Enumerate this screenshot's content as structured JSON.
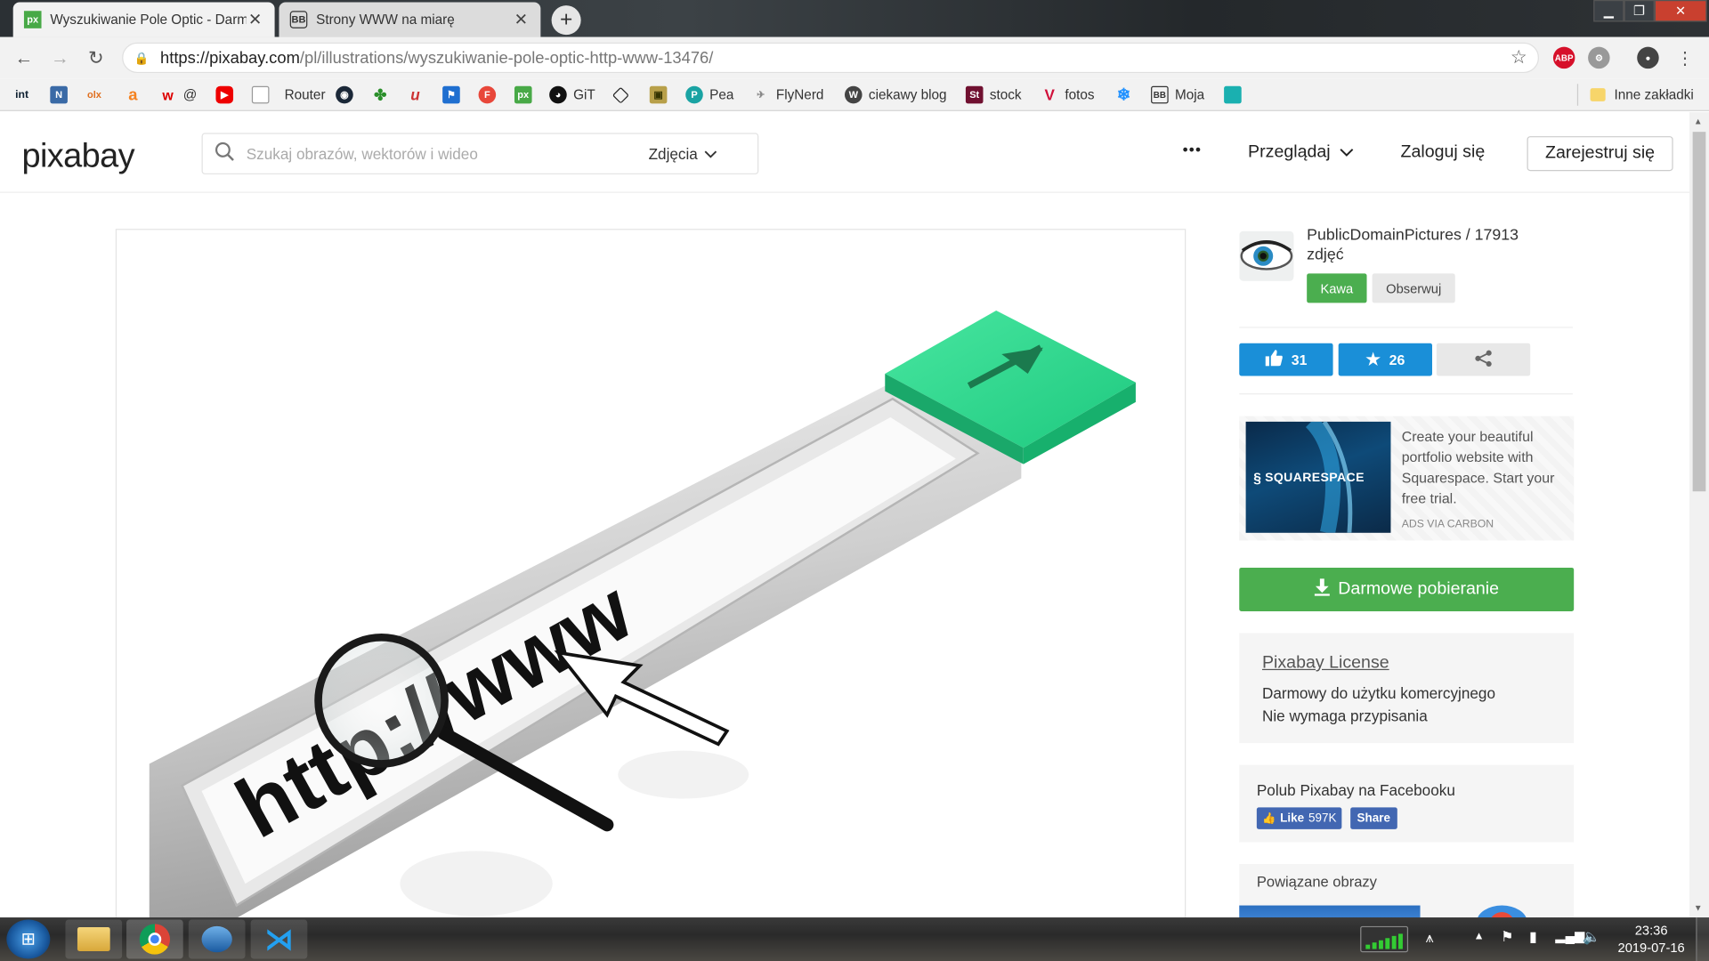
{
  "browser": {
    "tabs": [
      {
        "icon": "px",
        "label": "Wyszukiwanie Pole Optic - Darm",
        "active": true
      },
      {
        "icon": "BB",
        "label": "Strony WWW na miarę",
        "active": false
      }
    ],
    "url_host": "https://pixabay.com",
    "url_path": "/pl/illustrations/wyszukiwanie-pole-optic-http-www-13476/",
    "extensions": [
      "ABP"
    ]
  },
  "bookmarks": [
    {
      "icon": "int",
      "label": ""
    },
    {
      "icon": "N",
      "label": ""
    },
    {
      "icon": "olx",
      "label": ""
    },
    {
      "icon": "a",
      "label": ""
    },
    {
      "icon": "w",
      "label": "@"
    },
    {
      "icon": "youtube",
      "label": ""
    },
    {
      "icon": "page",
      "label": "Router"
    },
    {
      "icon": "steam",
      "label": ""
    },
    {
      "icon": "green",
      "label": ""
    },
    {
      "icon": "u",
      "label": ""
    },
    {
      "icon": "flag",
      "label": ""
    },
    {
      "icon": "F",
      "label": ""
    },
    {
      "icon": "px",
      "label": ""
    },
    {
      "icon": "github",
      "label": "GiT"
    },
    {
      "icon": "codepen",
      "label": ""
    },
    {
      "icon": "game",
      "label": ""
    },
    {
      "icon": "P",
      "label": "Pea"
    },
    {
      "icon": "plane",
      "label": "FlyNerd"
    },
    {
      "icon": "wp",
      "label": "ciekawy blog"
    },
    {
      "icon": "St",
      "label": "stock"
    },
    {
      "icon": "V",
      "label": "fotos"
    },
    {
      "icon": "snow",
      "label": ""
    },
    {
      "icon": "BB",
      "label": "Moja"
    },
    {
      "icon": "teal",
      "label": ""
    }
  ],
  "bookmarks_other": "Inne zakładki",
  "header": {
    "logo": "pixabay",
    "search_placeholder": "Szukaj obrazów, wektorów i wideo",
    "search_type": "Zdjęcia",
    "more": "•••",
    "browse": "Przeglądaj",
    "login": "Zaloguj się",
    "register": "Zarejestruj się"
  },
  "image": {
    "text": "http://www"
  },
  "author": {
    "name_line1": "PublicDomainPictures / 17913",
    "name_line2": "zdjęć",
    "coffee": "Kawa",
    "follow": "Obserwuj"
  },
  "stats": {
    "likes": "31",
    "favorites": "26"
  },
  "ad": {
    "brand": "SQUARESPACE",
    "text": "Create your beautiful portfolio website with Squarespace. Start your free trial.",
    "footer": "ADS VIA CARBON"
  },
  "download": {
    "label": "Darmowe pobieranie"
  },
  "license": {
    "title": "Pixabay License",
    "line1": "Darmowy do użytku komercyjnego",
    "line2": "Nie wymaga przypisania"
  },
  "facebook": {
    "title": "Polub Pixabay na Facebooku",
    "like": "Like",
    "like_count": "597K",
    "share": "Share"
  },
  "related": {
    "title": "Powiązane obrazy"
  },
  "taskbar": {
    "time": "23:36",
    "date": "2019-07-16"
  },
  "colors": {
    "green": "#4bae4f",
    "blue": "#1a8fd8",
    "fb_blue": "#4267b2"
  }
}
